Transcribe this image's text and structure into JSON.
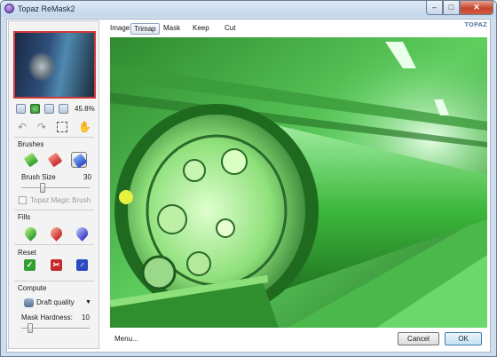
{
  "window": {
    "title": "Topaz ReMask2",
    "minimize": "–",
    "maximize": "□",
    "close": "✕"
  },
  "preview": {
    "zoom": "45.8%"
  },
  "brushes": {
    "section": "Brushes",
    "size_label": "Brush Size",
    "size_value": "30",
    "size_level": 0.3,
    "magic_brush_label": "Topaz Magic Brush"
  },
  "fills": {
    "section": "Fills"
  },
  "reset": {
    "section": "Reset"
  },
  "compute": {
    "section": "Compute",
    "quality": "Draft quality",
    "hardness_label": "Mask Hardness:",
    "hardness_value": "10",
    "hardness_level": 0.1
  },
  "tabs": [
    {
      "label": "Image",
      "active": false
    },
    {
      "label": "Trimap",
      "active": true
    },
    {
      "label": "Mask",
      "active": false
    },
    {
      "label": "Keep",
      "active": false
    },
    {
      "label": "Cut",
      "active": false
    }
  ],
  "logo": {
    "text": "TOPAZ"
  },
  "footer": {
    "menu": "Menu...",
    "cancel": "Cancel",
    "ok": "OK"
  },
  "colors": {
    "trimap_keep": "#3dd13d",
    "trimap_cut": "#e03030",
    "trimap_compute": "#2a55d0"
  }
}
